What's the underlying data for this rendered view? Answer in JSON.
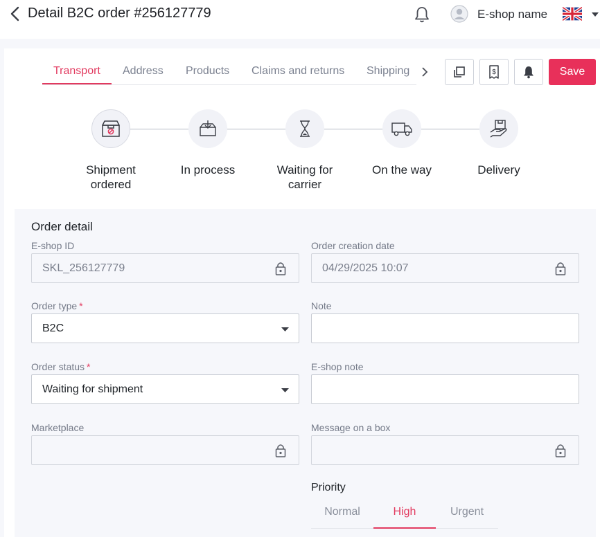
{
  "header": {
    "title": "Detail B2C order #256127779",
    "shop_name": "E-shop name",
    "language": "UK flag"
  },
  "tabs": [
    {
      "label": "Transport",
      "active": true
    },
    {
      "label": "Address"
    },
    {
      "label": "Products"
    },
    {
      "label": "Claims and returns"
    },
    {
      "label": "Shipping"
    }
  ],
  "toolbar": {
    "icons": [
      "copy-icon",
      "invoice-icon",
      "bell-icon"
    ],
    "save_label": "Save"
  },
  "steps": [
    {
      "line1": "Shipment",
      "line2": "ordered",
      "icon": "box-icon",
      "active": true
    },
    {
      "line1": "In process",
      "line2": "",
      "icon": "package-download-icon"
    },
    {
      "line1": "Waiting for",
      "line2": "carrier",
      "icon": "hourglass-icon"
    },
    {
      "line1": "On the way",
      "line2": "",
      "icon": "truck-icon"
    },
    {
      "line1": "Delivery",
      "line2": "",
      "icon": "hand-package-icon"
    }
  ],
  "form": {
    "title": "Order detail",
    "eshop_id": {
      "label": "E-shop ID",
      "value": "SKL_256127779"
    },
    "creation_date": {
      "label": "Order creation date",
      "value": "04/29/2025 10:07"
    },
    "order_type": {
      "label": "Order type",
      "value": "B2C",
      "required_mark": "*"
    },
    "note": {
      "label": "Note",
      "value": ""
    },
    "order_status": {
      "label": "Order status",
      "value": "Waiting for shipment",
      "required_mark": "*"
    },
    "eshop_note": {
      "label": "E-shop note",
      "value": ""
    },
    "marketplace": {
      "label": "Marketplace",
      "value": ""
    },
    "message_box": {
      "label": "Message on a box",
      "value": ""
    }
  },
  "priority": {
    "label": "Priority",
    "options": [
      "Normal",
      "High",
      "Urgent"
    ],
    "selected": "High"
  },
  "colors": {
    "accent": "#e8305a",
    "panel": "#f6f7fb"
  }
}
